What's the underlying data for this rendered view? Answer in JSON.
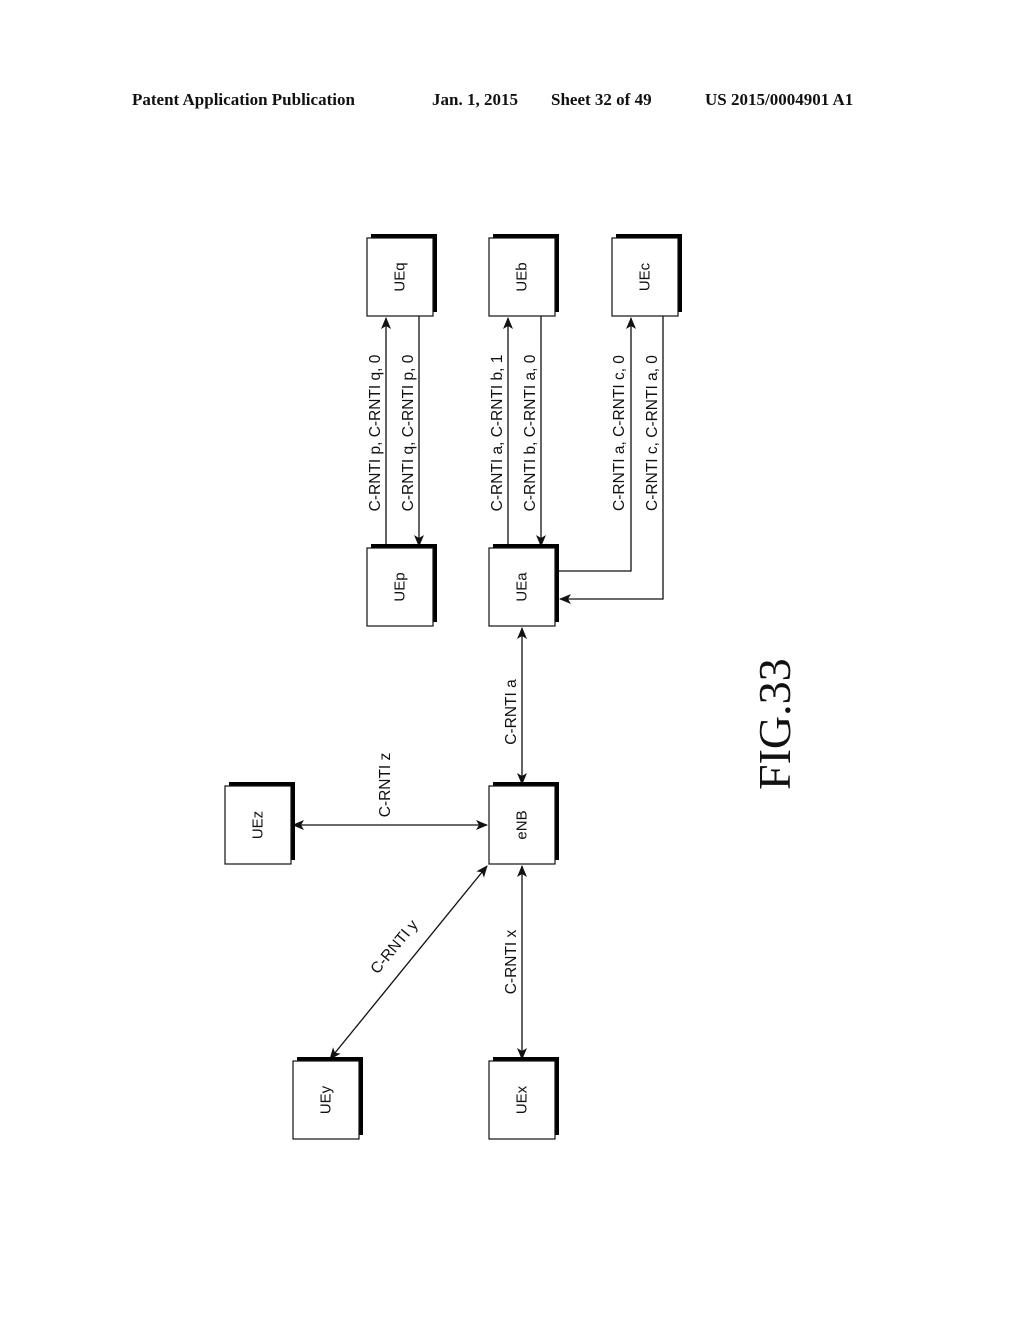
{
  "header": {
    "publication": "Patent Application Publication",
    "date": "Jan. 1, 2015",
    "sheet": "Sheet 32 of 49",
    "document_number": "US 2015/0004901 A1"
  },
  "figure": {
    "label": "FIG.33",
    "nodes": [
      {
        "id": "UEq",
        "label": "UEq"
      },
      {
        "id": "UEp",
        "label": "UEp"
      },
      {
        "id": "UEb",
        "label": "UEb"
      },
      {
        "id": "UEa",
        "label": "UEa"
      },
      {
        "id": "UEc",
        "label": "UEc"
      },
      {
        "id": "eNB",
        "label": "eNB"
      },
      {
        "id": "UEz",
        "label": "UEz"
      },
      {
        "id": "UEy",
        "label": "UEy"
      },
      {
        "id": "UEx",
        "label": "UEx"
      }
    ],
    "links": [
      {
        "id": "p-to-q",
        "from": "UEp",
        "to": "UEq",
        "direction": "one-way",
        "label": "C-RNTI p, C-RNTI q, 0"
      },
      {
        "id": "q-to-p",
        "from": "UEq",
        "to": "UEp",
        "direction": "one-way",
        "label": "C-RNTI q, C-RNTI p, 0"
      },
      {
        "id": "a-to-b",
        "from": "UEa",
        "to": "UEb",
        "direction": "one-way",
        "label": "C-RNTI a, C-RNTI b, 1"
      },
      {
        "id": "b-to-a",
        "from": "UEb",
        "to": "UEa",
        "direction": "one-way",
        "label": "C-RNTI b, C-RNTI a, 0"
      },
      {
        "id": "a-to-c",
        "from": "UEa",
        "to": "UEc",
        "direction": "one-way",
        "label": "C-RNTI a, C-RNTI c, 0"
      },
      {
        "id": "c-to-a",
        "from": "UEc",
        "to": "UEa",
        "direction": "one-way",
        "label": "C-RNTI c, C-RNTI a, 0"
      },
      {
        "id": "enb-ua",
        "from": "eNB",
        "to": "UEa",
        "direction": "two-way",
        "label": "C-RNTI a"
      },
      {
        "id": "enb-uz",
        "from": "eNB",
        "to": "UEz",
        "direction": "two-way",
        "label": "C-RNTI z"
      },
      {
        "id": "enb-uy",
        "from": "eNB",
        "to": "UEy",
        "direction": "two-way",
        "label": "C-RNTI y"
      },
      {
        "id": "enb-ux",
        "from": "eNB",
        "to": "UEx",
        "direction": "two-way",
        "label": "C-RNTI x"
      }
    ]
  }
}
